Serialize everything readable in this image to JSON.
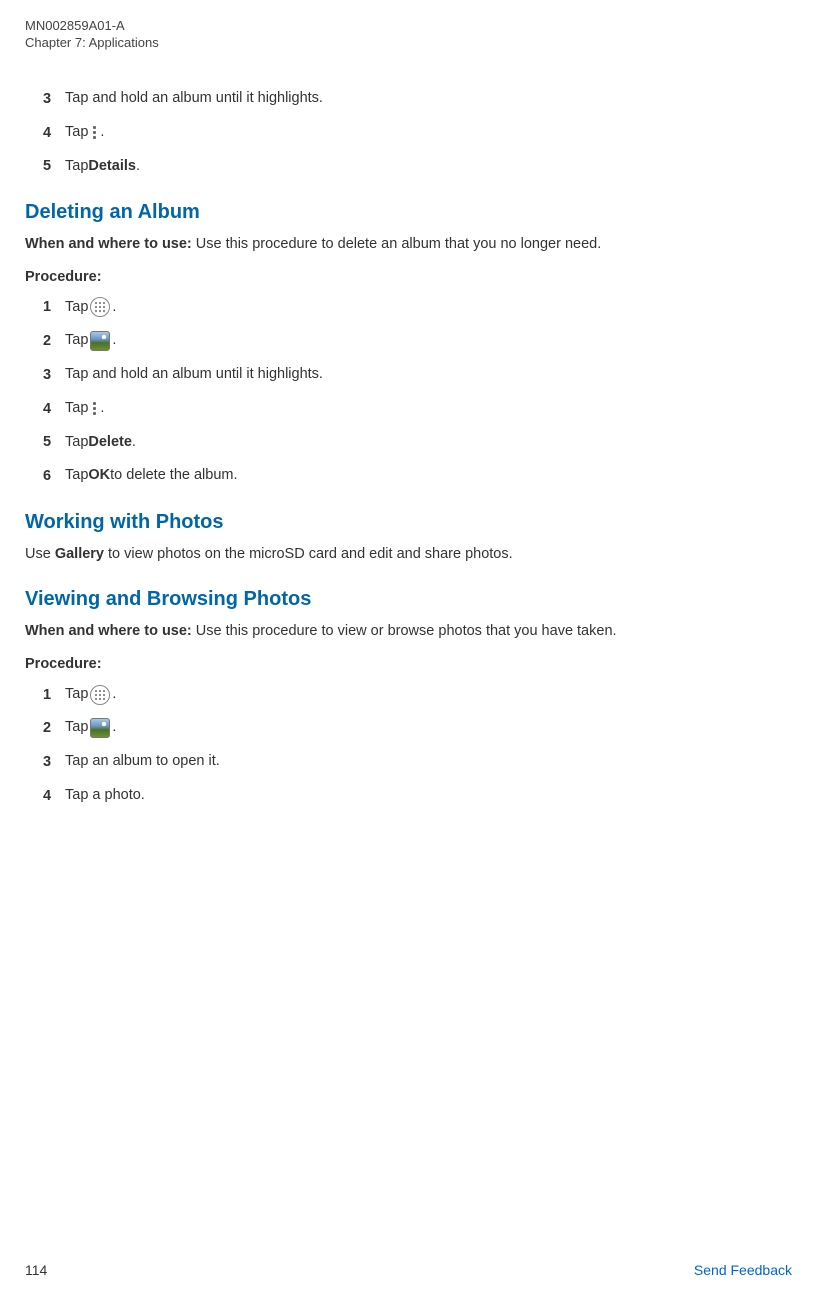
{
  "header": {
    "doc_id": "MN002859A01-A",
    "chapter": "Chapter 7:  Applications"
  },
  "intro_steps": {
    "s3": {
      "num": "3",
      "text": "Tap and hold an album until it highlights."
    },
    "s4": {
      "num": "4",
      "tap": "Tap ",
      "period": "."
    },
    "s5": {
      "num": "5",
      "tap": "Tap ",
      "bold": "Details",
      "period": "."
    }
  },
  "section_delete": {
    "heading": "Deleting an Album",
    "usage_label": "When and where to use: ",
    "usage_text": "Use this procedure to delete an album that you no longer need.",
    "procedure_label": "Procedure:",
    "steps": {
      "s1": {
        "num": "1",
        "tap": "Tap ",
        "period": "."
      },
      "s2": {
        "num": "2",
        "tap": "Tap ",
        "period": "."
      },
      "s3": {
        "num": "3",
        "text": "Tap and hold an album until it highlights."
      },
      "s4": {
        "num": "4",
        "tap": "Tap ",
        "period": "."
      },
      "s5": {
        "num": "5",
        "tap": "Tap ",
        "bold": "Delete",
        "period": "."
      },
      "s6": {
        "num": "6",
        "tap": "Tap ",
        "bold": "OK",
        "rest": " to delete the album."
      }
    }
  },
  "section_working": {
    "heading": "Working with Photos",
    "use_pre": "Use ",
    "use_bold": "Gallery",
    "use_post": " to view photos on the microSD card and edit and share photos."
  },
  "section_viewing": {
    "heading": "Viewing and Browsing Photos",
    "usage_label": "When and where to use: ",
    "usage_text": "Use this procedure to view or browse photos that you have taken.",
    "procedure_label": "Procedure:",
    "steps": {
      "s1": {
        "num": "1",
        "tap": "Tap ",
        "period": "."
      },
      "s2": {
        "num": "2",
        "tap": "Tap ",
        "period": " ."
      },
      "s3": {
        "num": "3",
        "text": "Tap an album to open it."
      },
      "s4": {
        "num": "4",
        "text": "Tap a photo."
      }
    }
  },
  "footer": {
    "page": "114",
    "link": "Send Feedback"
  }
}
